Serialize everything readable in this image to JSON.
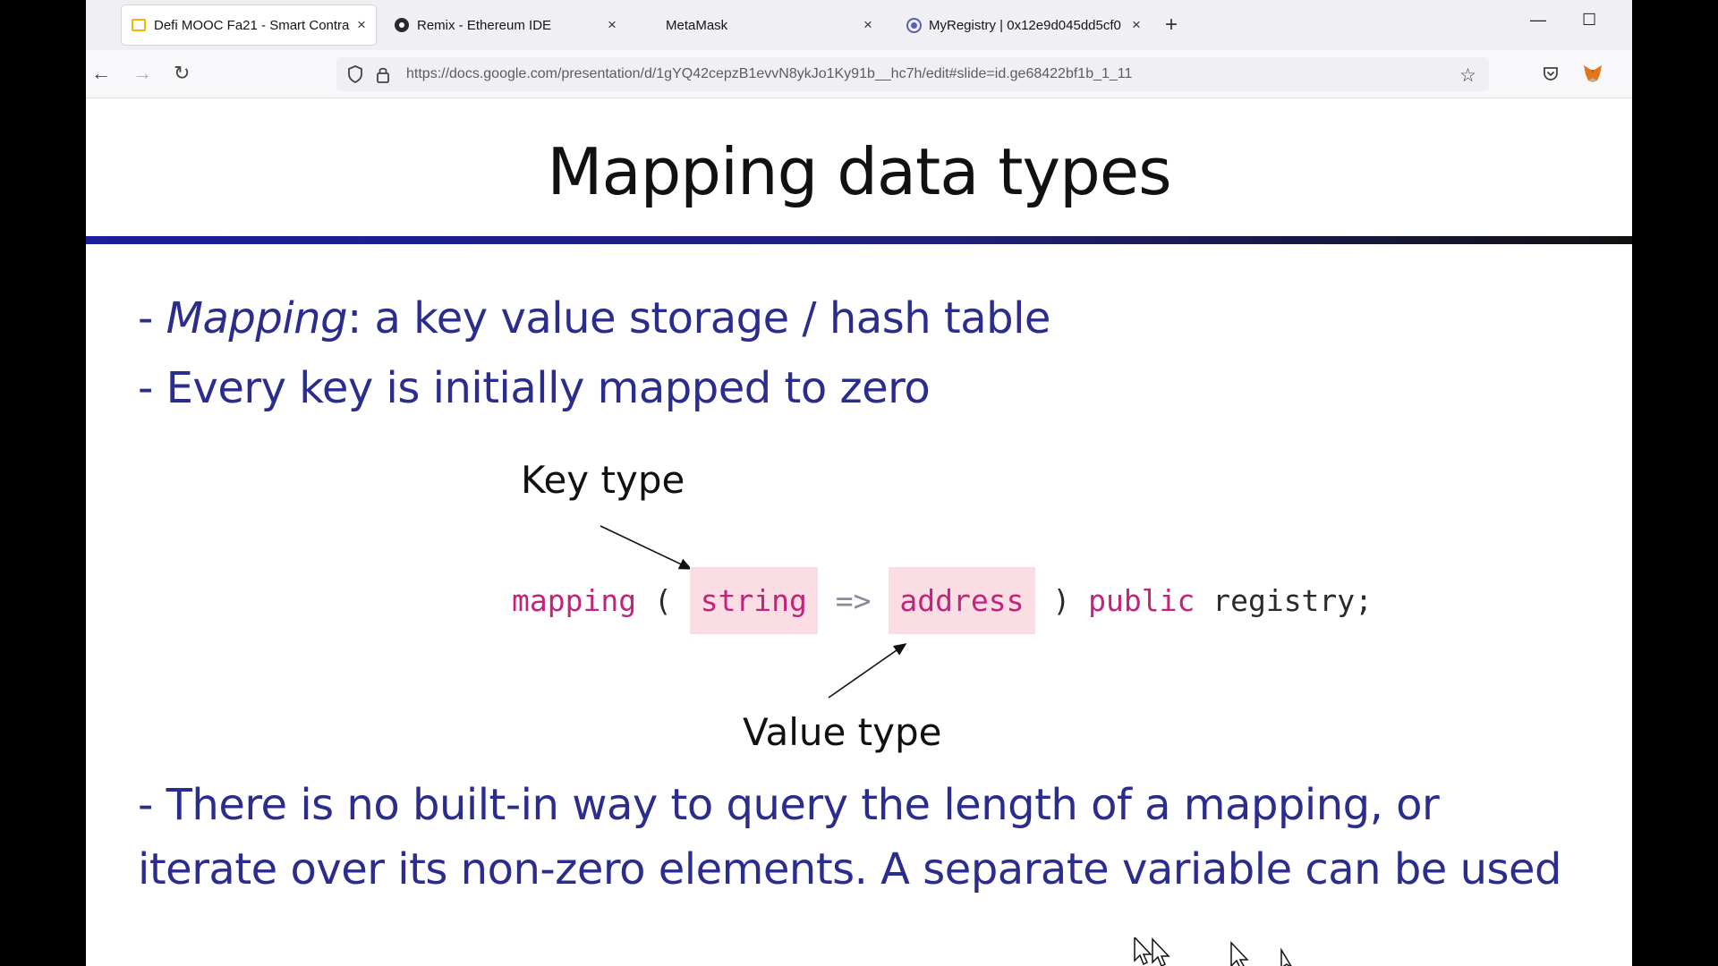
{
  "browser": {
    "tabs": [
      {
        "label": "Defi MOOC Fa21 - Smart Contra",
        "icon": "slides-icon",
        "active": true,
        "close": "×"
      },
      {
        "label": "Remix - Ethereum IDE",
        "icon": "remix-icon",
        "active": false,
        "close": "×"
      },
      {
        "label": "MetaMask",
        "icon": "",
        "active": false,
        "close": "×"
      },
      {
        "label": "MyRegistry | 0x12e9d045dd5cf0",
        "icon": "registry-icon",
        "active": false,
        "close": "×"
      }
    ],
    "new_tab": "+",
    "window_controls": {
      "minimize": "—",
      "maximize": "☐"
    },
    "nav": {
      "back": "←",
      "forward": "→",
      "reload": "↻"
    },
    "url": "https://docs.google.com/presentation/d/1gYQ42cepzB1evvN8ykJo1Ky91b__hc7h/edit#slide=id.ge68422bf1b_1_11",
    "bookmark_star": "☆"
  },
  "slide": {
    "title": "Mapping data types",
    "bullet1_dash": "- ",
    "bullet1_term": "Mapping",
    "bullet1_rest": ": a key value storage / hash table",
    "bullet2": "- Every key is initially mapped to zero",
    "key_type_label": "Key type",
    "value_type_label": "Value type",
    "code": {
      "kw_mapping": "mapping",
      "open_paren": "(",
      "key_type": "string",
      "arrow": "=>",
      "value_type": "address",
      "close_paren": ")",
      "kw_public": "public",
      "name": "registry;"
    },
    "bullet3_line1": "- There is no built-in way to query the length of a mapping, or",
    "bullet3_line2": "iterate over its non-zero elements. A separate variable can be used"
  },
  "colors": {
    "bullet_text": "#2b2d8c",
    "keyword": "#c2237b",
    "highlight": "#fbdde4",
    "title_rule": "#1a1f9a"
  }
}
